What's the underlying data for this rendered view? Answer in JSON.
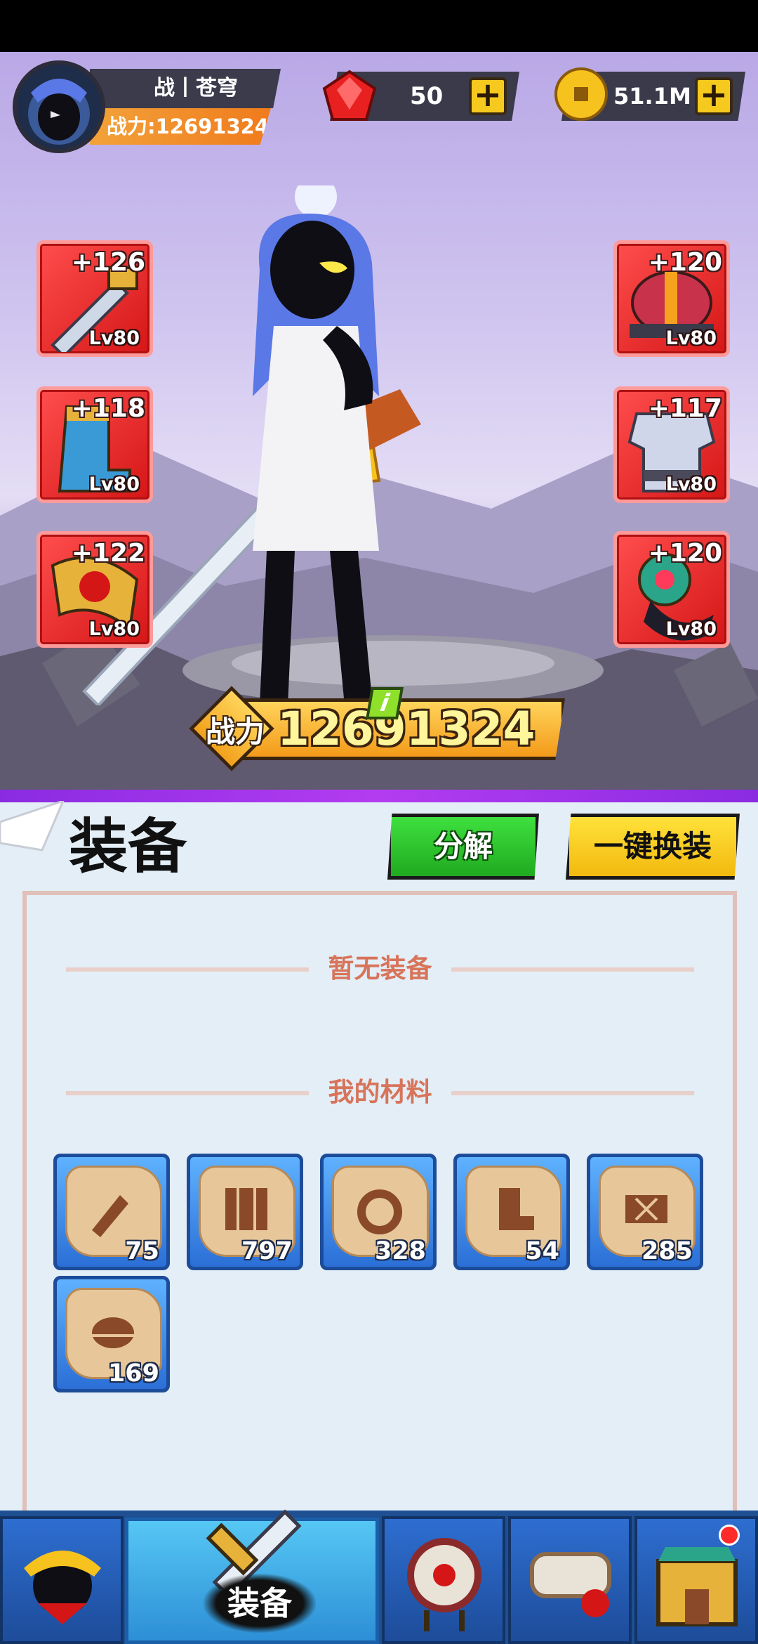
{
  "header": {
    "player_name": "战丨苍穹",
    "power_label": "战力:12691324",
    "gems": "50",
    "coins": "51.1M"
  },
  "equipment_slots": {
    "left": [
      {
        "bonus": "+126",
        "level": "Lv80",
        "icon": "sword-icon"
      },
      {
        "bonus": "+118",
        "level": "Lv80",
        "icon": "boots-icon"
      },
      {
        "bonus": "+122",
        "level": "Lv80",
        "icon": "belt-icon"
      }
    ],
    "right": [
      {
        "bonus": "+120",
        "level": "Lv80",
        "icon": "helmet-icon"
      },
      {
        "bonus": "+117",
        "level": "Lv80",
        "icon": "armor-icon"
      },
      {
        "bonus": "+120",
        "level": "Lv80",
        "icon": "ring-icon"
      }
    ]
  },
  "power_banner": {
    "label": "战力",
    "value": "12691324",
    "info": "i"
  },
  "panel": {
    "title": "装备",
    "decompose_button": "分解",
    "equip_all_button": "一键换装",
    "no_equipment_text": "暂无装备",
    "materials_title": "我的材料",
    "materials": [
      {
        "count": "75",
        "icon": "sword-scroll-icon"
      },
      {
        "count": "797",
        "icon": "armor-scroll-icon"
      },
      {
        "count": "328",
        "icon": "ring-scroll-icon"
      },
      {
        "count": "54",
        "icon": "boots-scroll-icon"
      },
      {
        "count": "285",
        "icon": "belt-scroll-icon"
      },
      {
        "count": "169",
        "icon": "helmet-scroll-icon"
      }
    ]
  },
  "nav": {
    "active_label": "装备",
    "items": [
      "hero-icon",
      "equipment-icon",
      "drum-icon",
      "scroll-cannon-icon",
      "castle-icon"
    ]
  },
  "colors": {
    "slot_red": "#e02020",
    "material_blue": "#3a8ae6",
    "accent_orange": "#f39a1a",
    "panel_bg": "#e4eef6"
  }
}
